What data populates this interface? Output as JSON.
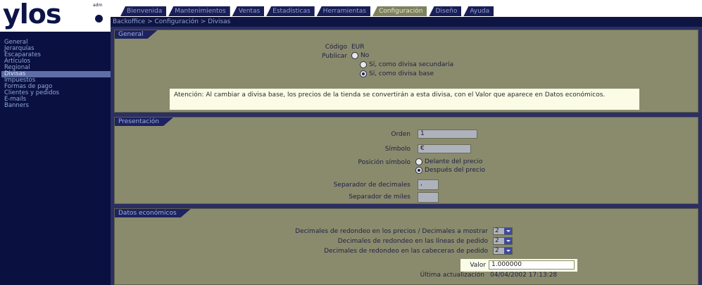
{
  "logo": {
    "text": "ylos",
    "small": "adm"
  },
  "tabs": [
    {
      "label": "Bienvenida"
    },
    {
      "label": "Mantenimientos"
    },
    {
      "label": "Ventas"
    },
    {
      "label": "Estadísticas"
    },
    {
      "label": "Herramientas"
    },
    {
      "label": "Configuración",
      "active": true
    },
    {
      "label": "Diseño"
    },
    {
      "label": "Ayuda"
    }
  ],
  "breadcrumb": "Backoffice > Configuración > Divisas",
  "sidebar": {
    "items": [
      {
        "label": "General"
      },
      {
        "label": "Jerarquías"
      },
      {
        "label": "Escaparates"
      },
      {
        "label": "Artículos"
      },
      {
        "label": "Regional"
      },
      {
        "label": "Divisas",
        "active": true
      },
      {
        "label": "Impuestos"
      },
      {
        "label": "Formas de pago"
      },
      {
        "label": "Clientes y pedidos"
      },
      {
        "label": "E-mails"
      },
      {
        "label": "Banners"
      }
    ]
  },
  "general": {
    "title": "General",
    "codigo_label": "Código",
    "codigo_value": "EUR",
    "publicar_label": "Publicar",
    "options": [
      {
        "label": "No",
        "selected": false
      },
      {
        "label": "Sí, como divisa secundaria",
        "selected": false
      },
      {
        "label": "Sí, como divisa base",
        "selected": true
      }
    ],
    "notice": "Atención: Al cambiar a divisa base, los precios de la tienda se convertirán a esta divisa, con el Valor que aparece en Datos económicos."
  },
  "presentacion": {
    "title": "Presentación",
    "orden_label": "Orden",
    "orden_value": "1",
    "simbolo_label": "Símbolo",
    "simbolo_value": "€",
    "posicion_label": "Posición símbolo",
    "posicion_options": [
      {
        "label": "Delante del precio",
        "selected": false
      },
      {
        "label": "Después del precio",
        "selected": true
      }
    ],
    "sep_decimales_label": "Separador de decimales",
    "sep_decimales_value": ",",
    "sep_miles_label": "Separador de miles",
    "sep_miles_value": ""
  },
  "economicos": {
    "title": "Datos económicos",
    "rows": [
      {
        "label": "Decimales de redondeo en los precios / Decimales a mostrar",
        "value": "2"
      },
      {
        "label": "Decimales de redondeo en las líneas de pedido",
        "value": "2"
      },
      {
        "label": "Decimales de redondeo en las cabeceras de pedido",
        "value": "2"
      }
    ],
    "valor_label": "Valor",
    "valor_value": "1.000000",
    "ultima_label": "Última actualización",
    "ultima_value": "04/04/2002 17:13:28"
  },
  "colors": {
    "sidebar_bg": "#0a1040",
    "panel_bg": "#8a8b6d",
    "main_bg": "#2b2f63",
    "active_tab": "#7d815e",
    "notice_bg": "#fbfce6"
  }
}
